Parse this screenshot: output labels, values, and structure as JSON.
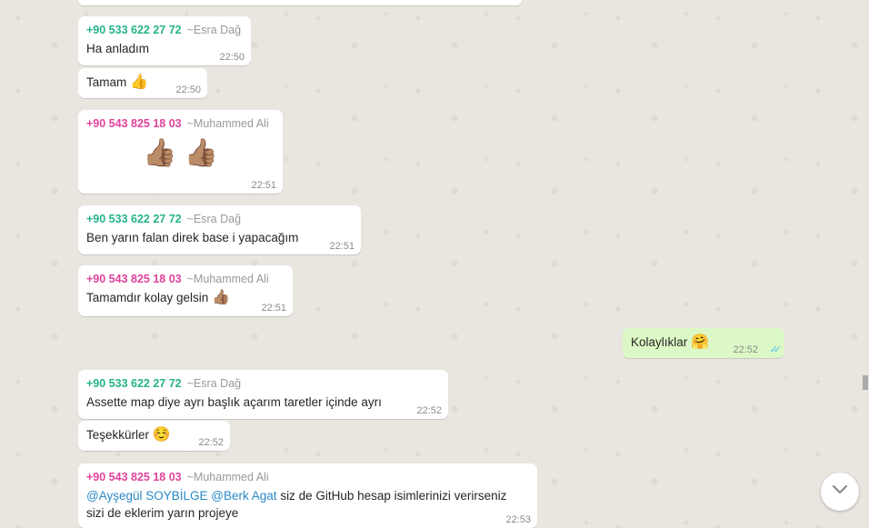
{
  "messages": [
    {
      "phone": "+90 533 622 27 72",
      "name": "~Esra Dağ",
      "text": "Ha anladım",
      "time": "22:50"
    },
    {
      "text": "Tamam",
      "emoji": "👍",
      "time": "22:50"
    },
    {
      "phone": "+90 543 825 18 03",
      "name": "~Muhammed Ali",
      "emoji": "👍🏽 👍🏽",
      "time": "22:51"
    },
    {
      "phone": "+90 533 622 27 72",
      "name": "~Esra Dağ",
      "text": "Ben yarın falan direk base i yapacağım",
      "time": "22:51"
    },
    {
      "phone": "+90 543 825 18 03",
      "name": "~Muhammed Ali",
      "text": "Tamamdır kolay gelsin",
      "emoji": "👍🏽",
      "time": "22:51"
    },
    {
      "text": "Kolaylıklar",
      "emoji": "🤗",
      "time": "22:52",
      "status": "read"
    },
    {
      "phone": "+90 533 622 27 72",
      "name": "~Esra Dağ",
      "text": "Assette map diye ayrı başlık açarım taretler içinde ayrı",
      "time": "22:52"
    },
    {
      "text": "Teşekkürler",
      "emoji": "☺️",
      "time": "22:52"
    },
    {
      "phone": "+90 543 825 18 03",
      "name": "~Muhammed Ali",
      "mention1": "@Ayşegül SOYBİLGE",
      "mention2": "@Berk Agat",
      "text": "siz de GitHub hesap isimlerinizi verirseniz sizi de eklerim yarın projeye",
      "time": "22:53"
    }
  ],
  "icons": {
    "scroll_down": "chevron-down-icon",
    "read_receipt": "double-check-icon"
  },
  "colors": {
    "sender_green": "#25b38a",
    "sender_pink": "#e0439c",
    "outgoing_bg": "#dcf8c6",
    "mention": "#2a89c7"
  }
}
